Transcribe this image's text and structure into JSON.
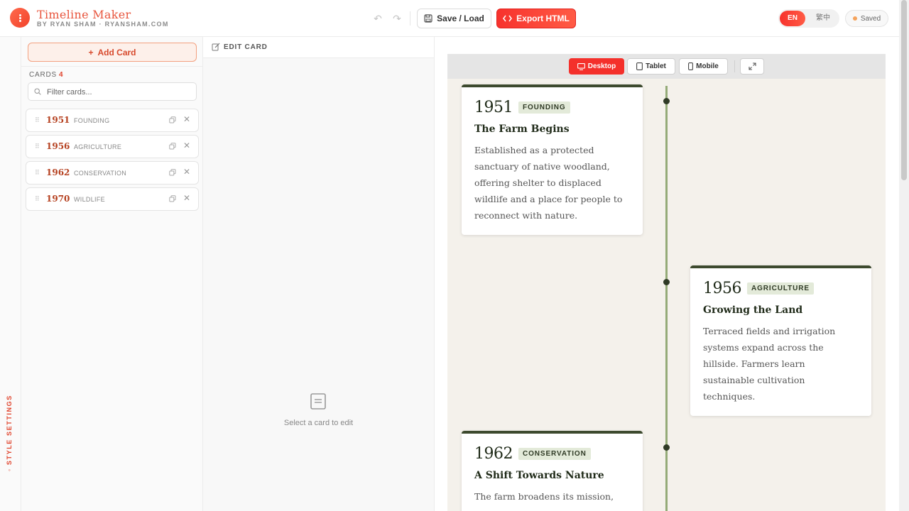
{
  "header": {
    "title": "Timeline Maker",
    "subtitle": "BY RYAN SHAM · RYANSHAM.COM",
    "save_label": "Save / Load",
    "export_label": "Export HTML",
    "lang_en": "EN",
    "lang_zh": "繁中",
    "status": "Saved"
  },
  "rail": {
    "label": "STYLE SETTINGS"
  },
  "cards_panel": {
    "add_label": "Add Card",
    "heading": "CARDS",
    "count": "4",
    "filter_placeholder": "Filter cards...",
    "items": [
      {
        "year": "1951",
        "tag": "FOUNDING"
      },
      {
        "year": "1956",
        "tag": "AGRICULTURE"
      },
      {
        "year": "1962",
        "tag": "CONSERVATION"
      },
      {
        "year": "1970",
        "tag": "WILDLIFE"
      }
    ]
  },
  "edit_panel": {
    "heading": "EDIT CARD",
    "empty_text": "Select a card to edit"
  },
  "preview": {
    "devices": {
      "desktop": "Desktop",
      "tablet": "Tablet",
      "mobile": "Mobile"
    },
    "cards": [
      {
        "year": "1951",
        "tag": "FOUNDING",
        "title": "The Farm Begins",
        "desc": "Established as a protected sanctuary of native woodland, offering shelter to displaced wildlife and a place for people to reconnect with nature."
      },
      {
        "year": "1956",
        "tag": "AGRICULTURE",
        "title": "Growing the Land",
        "desc": "Terraced fields and irrigation systems expand across the hillside. Farmers learn sustainable cultivation techniques."
      },
      {
        "year": "1962",
        "tag": "CONSERVATION",
        "title": "A Shift Towards Nature",
        "desc": "The farm broadens its mission,"
      }
    ]
  },
  "colors": {
    "accent": "#f4302b",
    "timeline": "#94ab78",
    "card_border": "#3d4a2e"
  }
}
